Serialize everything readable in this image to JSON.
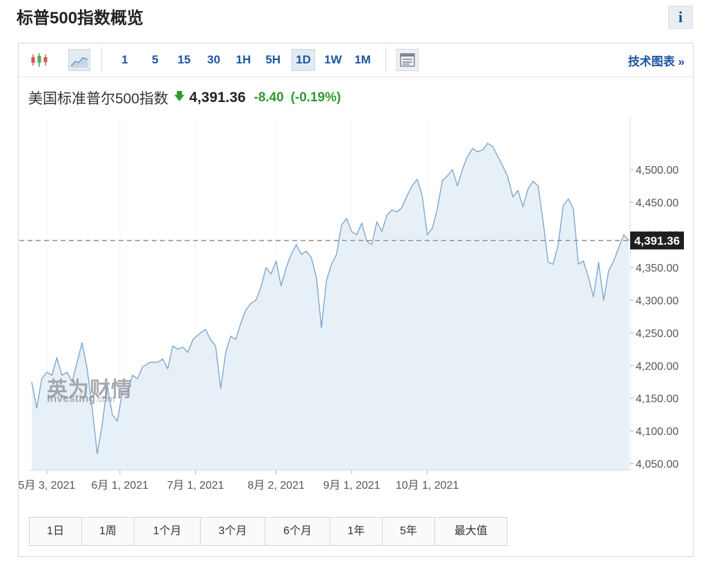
{
  "title": "标普500指数概览",
  "info_label": "i",
  "toolbar": {
    "intervals": [
      "1",
      "5",
      "15",
      "30",
      "1H",
      "5H",
      "1D",
      "1W",
      "1M"
    ],
    "active_interval": "1D",
    "tech_chart_link": "技术图表 »"
  },
  "quote": {
    "name": "美国标准普尔500指数",
    "price": "4,391.36",
    "change": "-8.40",
    "change_pct": "(-0.19%)"
  },
  "watermark": {
    "cn": "英为财情",
    "en_main": "Investing",
    "en_suffix": ".com"
  },
  "range_buttons": [
    "1日",
    "1周",
    "1个月",
    "3个月",
    "6个月",
    "1年",
    "5年",
    "最大值"
  ],
  "colors": {
    "line": "#7ba7cf",
    "area": "#e8f0f7",
    "accent": "#1a56a0",
    "down": "#2e9b2e",
    "price_tag_bg": "#1f1f1f"
  },
  "chart_data": {
    "type": "area",
    "y_axis_position": "right",
    "ylim": [
      4040,
      4580
    ],
    "yticks": [
      "4,050.00",
      "4,100.00",
      "4,150.00",
      "4,200.00",
      "4,250.00",
      "4,300.00",
      "4,350.00",
      "4,400.00",
      "4,450.00",
      "4,500.00"
    ],
    "ytick_values": [
      4050,
      4100,
      4150,
      4200,
      4250,
      4300,
      4350,
      4400,
      4450,
      4500
    ],
    "xticks": [
      "5月 3, 2021",
      "6月 1, 2021",
      "7月 1, 2021",
      "8月 2, 2021",
      "9月 1, 2021",
      "10月 1, 2021"
    ],
    "xtick_dates": [
      "2021-05-03",
      "2021-06-01",
      "2021-07-01",
      "2021-08-02",
      "2021-09-01",
      "2021-10-01"
    ],
    "last_price": 4391.36,
    "last_price_label": "4,391.36",
    "series": [
      {
        "points": [
          [
            "2021-04-27",
            4175
          ],
          [
            "2021-04-29",
            4135
          ],
          [
            "2021-05-01",
            4180
          ],
          [
            "2021-05-03",
            4190
          ],
          [
            "2021-05-05",
            4185
          ],
          [
            "2021-05-07",
            4212
          ],
          [
            "2021-05-09",
            4185
          ],
          [
            "2021-05-11",
            4190
          ],
          [
            "2021-05-13",
            4175
          ],
          [
            "2021-05-15",
            4205
          ],
          [
            "2021-05-17",
            4235
          ],
          [
            "2021-05-19",
            4195
          ],
          [
            "2021-05-21",
            4135
          ],
          [
            "2021-05-23",
            4065
          ],
          [
            "2021-05-25",
            4110
          ],
          [
            "2021-05-27",
            4170
          ],
          [
            "2021-05-29",
            4125
          ],
          [
            "2021-05-31",
            4115
          ],
          [
            "2021-06-02",
            4160
          ],
          [
            "2021-06-04",
            4160
          ],
          [
            "2021-06-06",
            4185
          ],
          [
            "2021-06-08",
            4180
          ],
          [
            "2021-06-10",
            4198
          ],
          [
            "2021-06-13",
            4205
          ],
          [
            "2021-06-16",
            4205
          ],
          [
            "2021-06-18",
            4210
          ],
          [
            "2021-06-20",
            4195
          ],
          [
            "2021-06-22",
            4230
          ],
          [
            "2021-06-24",
            4225
          ],
          [
            "2021-06-26",
            4228
          ],
          [
            "2021-06-28",
            4220
          ],
          [
            "2021-06-30",
            4240
          ],
          [
            "2021-07-03",
            4250
          ],
          [
            "2021-07-05",
            4255
          ],
          [
            "2021-07-07",
            4240
          ],
          [
            "2021-07-09",
            4230
          ],
          [
            "2021-07-11",
            4165
          ],
          [
            "2021-07-13",
            4220
          ],
          [
            "2021-07-15",
            4245
          ],
          [
            "2021-07-17",
            4240
          ],
          [
            "2021-07-19",
            4265
          ],
          [
            "2021-07-21",
            4285
          ],
          [
            "2021-07-23",
            4295
          ],
          [
            "2021-07-25",
            4300
          ],
          [
            "2021-07-27",
            4320
          ],
          [
            "2021-07-29",
            4350
          ],
          [
            "2021-07-31",
            4340
          ],
          [
            "2021-08-02",
            4360
          ],
          [
            "2021-08-04",
            4322
          ],
          [
            "2021-08-06",
            4350
          ],
          [
            "2021-08-08",
            4370
          ],
          [
            "2021-08-10",
            4385
          ],
          [
            "2021-08-12",
            4370
          ],
          [
            "2021-08-14",
            4375
          ],
          [
            "2021-08-16",
            4365
          ],
          [
            "2021-08-18",
            4335
          ],
          [
            "2021-08-20",
            4258
          ],
          [
            "2021-08-22",
            4330
          ],
          [
            "2021-08-24",
            4355
          ],
          [
            "2021-08-26",
            4370
          ],
          [
            "2021-08-28",
            4415
          ],
          [
            "2021-08-30",
            4425
          ],
          [
            "2021-09-01",
            4405
          ],
          [
            "2021-09-03",
            4400
          ],
          [
            "2021-09-05",
            4418
          ],
          [
            "2021-09-07",
            4390
          ],
          [
            "2021-09-09",
            4385
          ],
          [
            "2021-09-11",
            4420
          ],
          [
            "2021-09-13",
            4405
          ],
          [
            "2021-09-15",
            4430
          ],
          [
            "2021-09-17",
            4438
          ],
          [
            "2021-09-19",
            4435
          ],
          [
            "2021-09-21",
            4442
          ],
          [
            "2021-09-23",
            4460
          ],
          [
            "2021-09-25",
            4475
          ],
          [
            "2021-09-27",
            4485
          ],
          [
            "2021-09-29",
            4460
          ],
          [
            "2021-10-01",
            4400
          ],
          [
            "2021-10-03",
            4410
          ],
          [
            "2021-10-05",
            4440
          ],
          [
            "2021-10-07",
            4483
          ],
          [
            "2021-10-09",
            4490
          ],
          [
            "2021-10-11",
            4500
          ],
          [
            "2021-10-13",
            4475
          ],
          [
            "2021-10-15",
            4500
          ],
          [
            "2021-10-17",
            4520
          ],
          [
            "2021-10-19",
            4532
          ],
          [
            "2021-10-21",
            4527
          ],
          [
            "2021-10-23",
            4530
          ],
          [
            "2021-10-25",
            4540
          ],
          [
            "2021-10-27",
            4535
          ],
          [
            "2021-10-29",
            4520
          ],
          [
            "2021-10-31",
            4505
          ],
          [
            "2021-11-02",
            4488
          ],
          [
            "2021-11-04",
            4458
          ],
          [
            "2021-11-06",
            4468
          ],
          [
            "2021-11-08",
            4443
          ],
          [
            "2021-11-10",
            4470
          ],
          [
            "2021-11-12",
            4482
          ],
          [
            "2021-11-14",
            4475
          ],
          [
            "2021-11-16",
            4420
          ],
          [
            "2021-11-18",
            4358
          ],
          [
            "2021-11-20",
            4355
          ],
          [
            "2021-11-22",
            4385
          ],
          [
            "2021-11-24",
            4445
          ],
          [
            "2021-11-26",
            4455
          ],
          [
            "2021-11-28",
            4440
          ],
          [
            "2021-11-30",
            4355
          ],
          [
            "2021-12-02",
            4360
          ],
          [
            "2021-12-04",
            4335
          ],
          [
            "2021-12-06",
            4305
          ],
          [
            "2021-12-08",
            4358
          ],
          [
            "2021-12-10",
            4300
          ],
          [
            "2021-12-12",
            4345
          ],
          [
            "2021-12-14",
            4360
          ],
          [
            "2021-12-16",
            4380
          ],
          [
            "2021-12-18",
            4400
          ],
          [
            "2021-12-20",
            4391.36
          ]
        ]
      }
    ]
  }
}
